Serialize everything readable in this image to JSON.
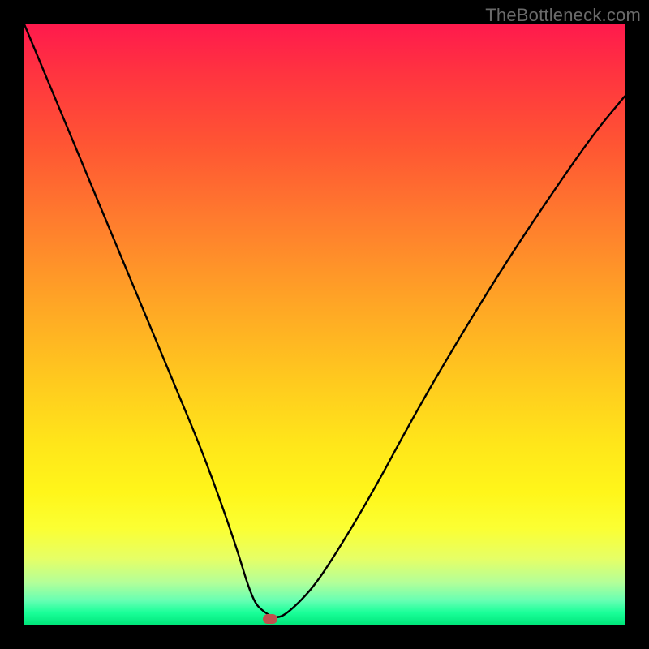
{
  "watermark": "TheBottleneck.com",
  "chart_data": {
    "type": "line",
    "title": "",
    "xlabel": "",
    "ylabel": "",
    "xlim": [
      0,
      100
    ],
    "ylim": [
      0,
      100
    ],
    "series": [
      {
        "name": "curve",
        "x": [
          0,
          5,
          10,
          15,
          20,
          25,
          30,
          35,
          38,
          40,
          42,
          44,
          48,
          52,
          58,
          65,
          72,
          80,
          88,
          95,
          100
        ],
        "values": [
          100,
          88,
          76,
          64,
          52,
          40,
          28,
          14,
          4,
          2,
          1,
          2,
          6,
          12,
          22,
          35,
          47,
          60,
          72,
          82,
          88
        ]
      }
    ],
    "marker": {
      "x": 41,
      "y": 1
    },
    "gradient_stops": [
      {
        "pct": 0,
        "color": "#ff1a4d"
      },
      {
        "pct": 8,
        "color": "#ff3340"
      },
      {
        "pct": 20,
        "color": "#ff5533"
      },
      {
        "pct": 32,
        "color": "#ff7a2e"
      },
      {
        "pct": 45,
        "color": "#ffa126"
      },
      {
        "pct": 58,
        "color": "#ffc61f"
      },
      {
        "pct": 70,
        "color": "#ffe61a"
      },
      {
        "pct": 78,
        "color": "#fff61a"
      },
      {
        "pct": 84,
        "color": "#fbff33"
      },
      {
        "pct": 89,
        "color": "#e6ff66"
      },
      {
        "pct": 93,
        "color": "#b3ff99"
      },
      {
        "pct": 96,
        "color": "#66ffb3"
      },
      {
        "pct": 98,
        "color": "#1aff99"
      },
      {
        "pct": 100,
        "color": "#00e67a"
      }
    ]
  }
}
